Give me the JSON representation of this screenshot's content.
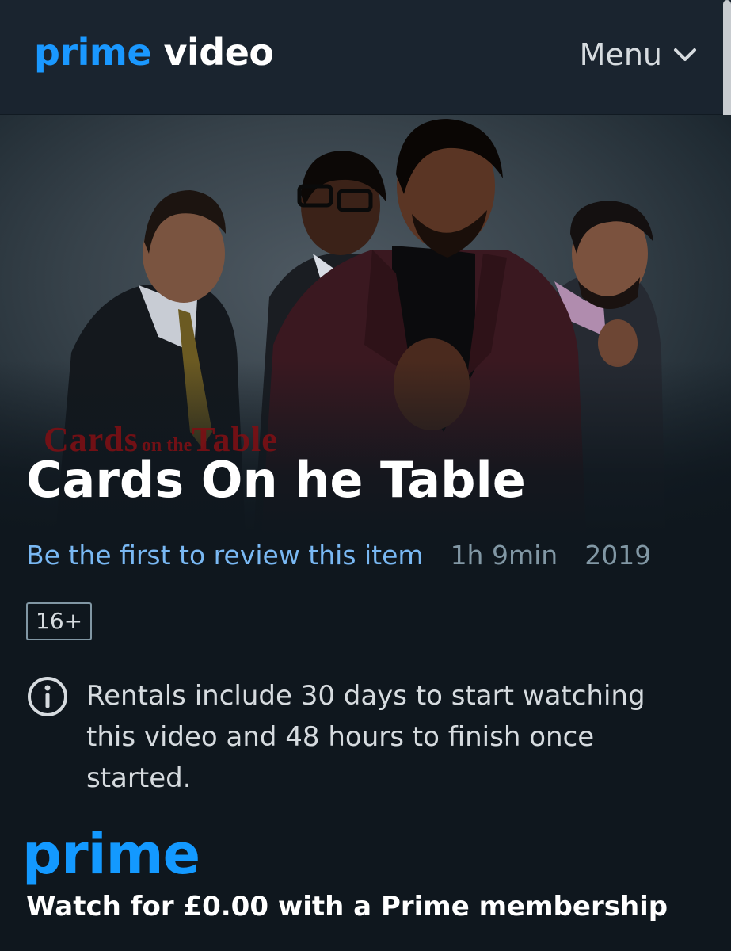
{
  "header": {
    "logo_prime": "prime",
    "logo_video": "video",
    "menu_label": "Menu",
    "menu_icon": "chevron-down-icon"
  },
  "hero": {
    "poster_watermark_big1": "Cards",
    "poster_watermark_small": "on the",
    "poster_watermark_big2": "Table"
  },
  "title": "Cards On he Table",
  "meta": {
    "review_link": "Be the first to review this item",
    "runtime": "1h 9min",
    "year": "2019"
  },
  "rating": "16+",
  "info": {
    "icon": "info-icon",
    "text": "Rentals include 30 days to start watching this video and 48 hours to finish once started."
  },
  "prime": {
    "badge": "prime",
    "offer": "Watch for £0.00 with a Prime membership"
  },
  "colors": {
    "background": "#0f171e",
    "header": "#1a242f",
    "brand_blue": "#1a98ff",
    "link_blue": "#79b8f3",
    "muted": "#8197a4"
  }
}
